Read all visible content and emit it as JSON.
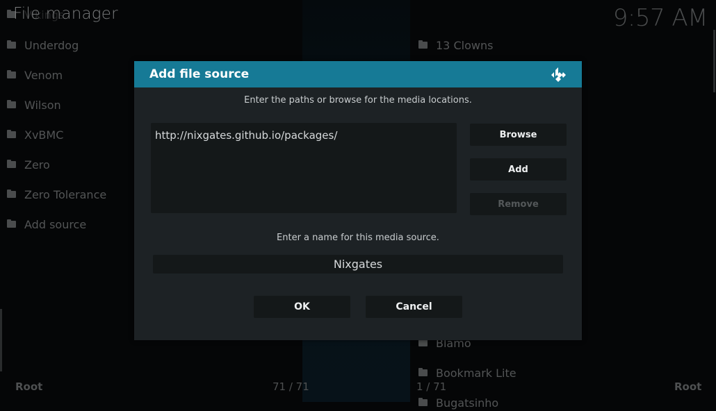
{
  "header": {
    "title": "File manager",
    "clock": "9:57 AM"
  },
  "left_pane": {
    "items": [
      {
        "label": "Vikings",
        "icon": "folder-icon"
      },
      {
        "label": "Underdog",
        "icon": "folder-icon"
      },
      {
        "label": "Venom",
        "icon": "folder-icon"
      },
      {
        "label": "Wilson",
        "icon": "folder-icon"
      },
      {
        "label": "XvBMC",
        "icon": "folder-icon"
      },
      {
        "label": "Zero",
        "icon": "folder-icon"
      },
      {
        "label": "Zero Tolerance",
        "icon": "folder-icon"
      },
      {
        "label": "Add source",
        "icon": "folder-icon"
      }
    ],
    "footer_path": "Root",
    "footer_count": "71 / 71"
  },
  "right_pane": {
    "items": [
      {
        "label": "13 Clowns",
        "icon": "folder-icon"
      },
      {
        "label": "Blamo",
        "icon": "folder-icon"
      },
      {
        "label": "Bookmark Lite",
        "icon": "folder-icon"
      },
      {
        "label": "Bugatsinho",
        "icon": "folder-icon"
      }
    ],
    "footer_count": "1 / 71",
    "footer_path": "Root"
  },
  "dialog": {
    "title": "Add file source",
    "logo_icon": "kodi-logo-icon",
    "paths_instruction": "Enter the paths or browse for the media locations.",
    "paths": [
      "http://nixgates.github.io/packages/"
    ],
    "buttons": {
      "browse": "Browse",
      "add": "Add",
      "remove": "Remove",
      "ok": "OK",
      "cancel": "Cancel"
    },
    "name_instruction": "Enter a name for this media source.",
    "name_value": "Nixgates"
  },
  "colors": {
    "accent": "#167a96",
    "dialog_bg": "#1d2225",
    "field_bg": "#141819",
    "background": "#050607"
  }
}
